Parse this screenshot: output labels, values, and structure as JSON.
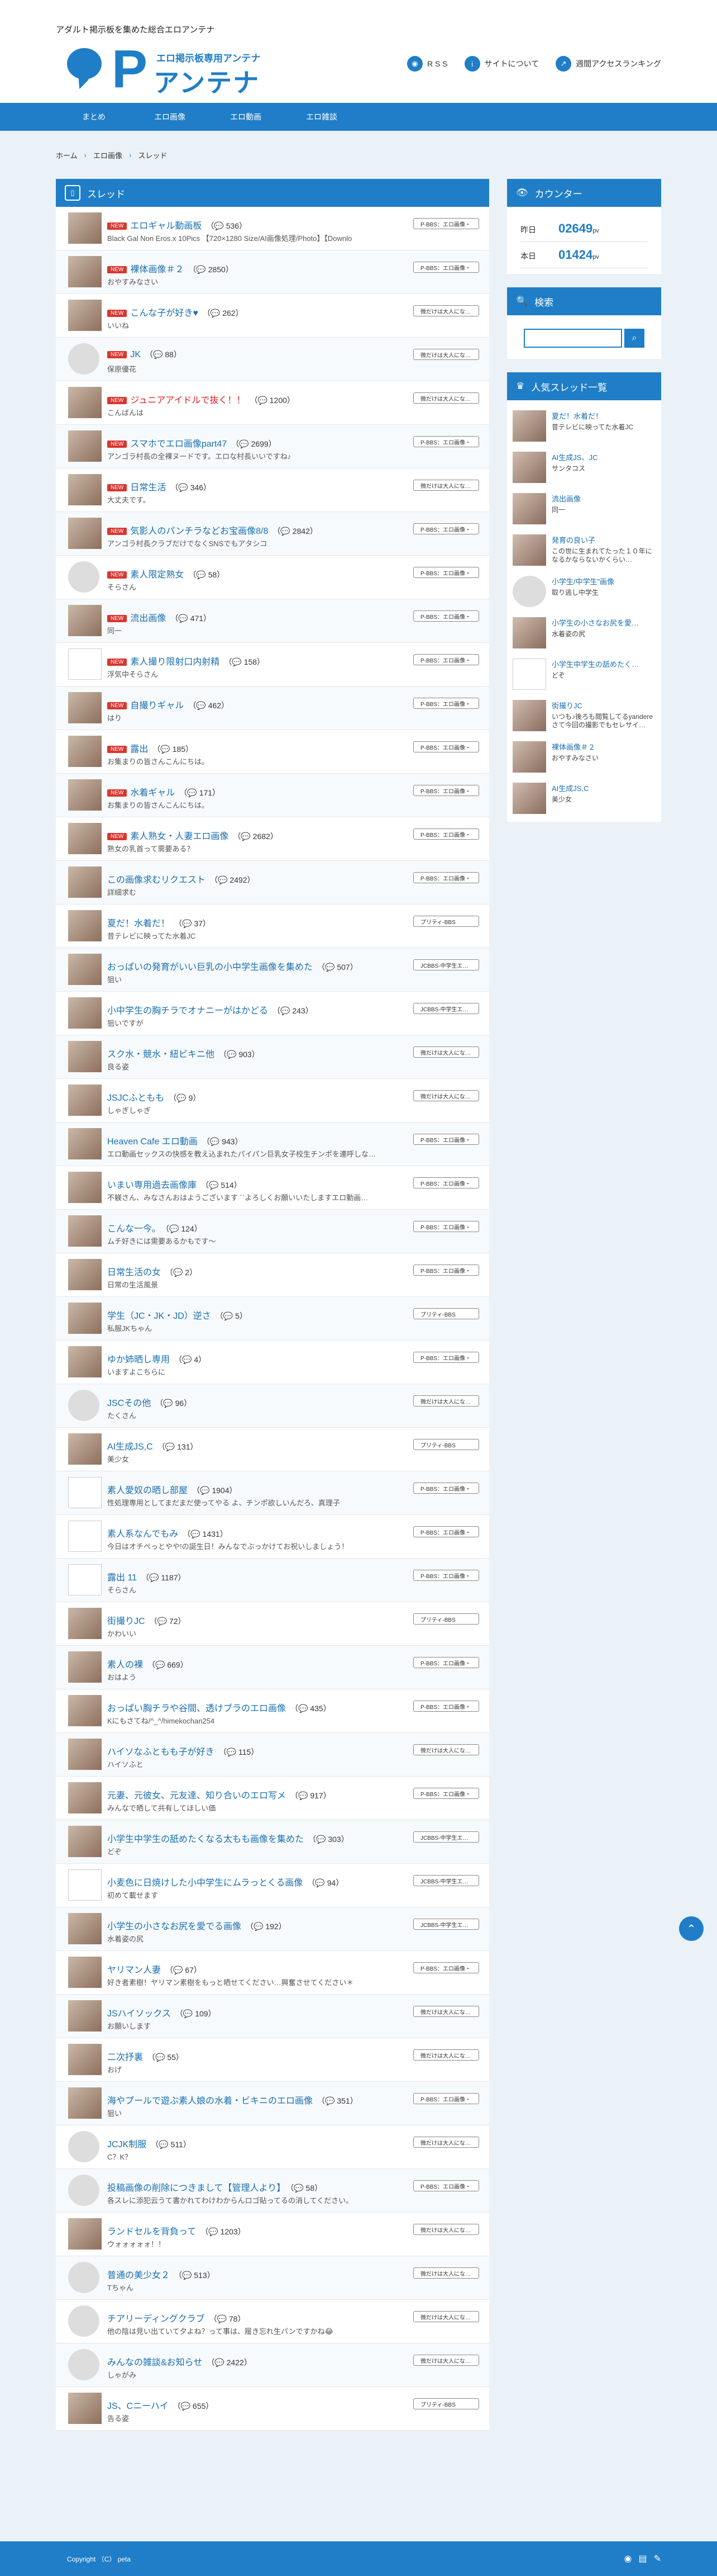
{
  "header": {
    "tagline": "アダルト掲示板を集めた総合エロアンテナ",
    "logo_letter": "P",
    "logo_sub": "エロ掲示板専用アンテナ",
    "logo_main": "アンテナ",
    "links": [
      {
        "icon": "rss-icon",
        "label": "R S S"
      },
      {
        "icon": "info-icon",
        "label": "サイトについて"
      },
      {
        "icon": "ranking-icon",
        "label": "週間アクセスランキング"
      }
    ]
  },
  "nav": [
    "まとめ",
    "エロ画像",
    "エロ動画",
    "エロ雑談"
  ],
  "breadcrumb": [
    "ホーム",
    "エロ画像",
    "スレッド"
  ],
  "threads_heading": "スレッド",
  "threads": [
    {
      "title": "エロギャル動画板",
      "new": true,
      "count": "536",
      "snippet": "Black Gal Non Eros.x 10Pics 【720×1280 Size/AI画像処理/Photo】【Downlo",
      "tag": "P-BBS：エロ画像・",
      "thumb": "photo"
    },
    {
      "title": "裸体画像＃２",
      "new": true,
      "count": "2850",
      "snippet": "おやすみなさい",
      "tag": "P-BBS：エロ画像・",
      "thumb": "photo"
    },
    {
      "title": "こんな子が好き♥",
      "new": true,
      "count": "262",
      "snippet": "いいね",
      "tag": "微だけは大人にな…",
      "thumb": "photo"
    },
    {
      "title": "JK",
      "new": true,
      "count": "88",
      "snippet": "保原優花",
      "tag": "微だけは大人にな…",
      "thumb": "avatar"
    },
    {
      "title": "ジュニアアイドルで抜く！！",
      "new": true,
      "count": "1200",
      "snippet": "こんばんは",
      "tag": "微だけは大人にな…",
      "thumb": "photo",
      "red": true
    },
    {
      "title": "スマホでエロ画像part47",
      "new": true,
      "count": "2699",
      "snippet": "アンゴラ村長の全裸ヌードです。エロな村長いいですね♪",
      "tag": "P-BBS：エロ画像・",
      "thumb": "photo"
    },
    {
      "title": "日常生活",
      "new": true,
      "count": "346",
      "snippet": "大丈夫です。",
      "tag": "微だけは大人にな…",
      "thumb": "photo"
    },
    {
      "title": "気影人のパンチラなどお宝画像8/8",
      "new": true,
      "count": "2842",
      "snippet": "アンゴラ村長クラブだけでなくSNSでもアタシコ",
      "tag": "P-BBS：エロ画像・",
      "thumb": "photo"
    },
    {
      "title": "素人限定熟女",
      "new": true,
      "count": "58",
      "snippet": "そらさん",
      "tag": "P-BBS：エロ画像・",
      "thumb": "avatar"
    },
    {
      "title": "流出画像",
      "new": true,
      "count": "471",
      "snippet": "同一",
      "tag": "P-BBS：エロ画像・",
      "thumb": "photo"
    },
    {
      "title": "素人撮り限射口内射精",
      "new": true,
      "count": "158",
      "snippet": "浮気中そらさん",
      "tag": "P-BBS：エロ画像・",
      "thumb": "blank"
    },
    {
      "title": "自撮りギャル",
      "new": true,
      "count": "462",
      "snippet": "はり",
      "tag": "P-BBS：エロ画像・",
      "thumb": "photo"
    },
    {
      "title": "露出",
      "new": true,
      "count": "185",
      "snippet": "お集まりの皆さんこんにちは。",
      "tag": "P-BBS：エロ画像・",
      "thumb": "photo"
    },
    {
      "title": "水着ギャル",
      "new": true,
      "count": "171",
      "snippet": "お集まりの皆さんこんにちは。",
      "tag": "P-BBS：エロ画像・",
      "thumb": "photo"
    },
    {
      "title": "素人熟女・人妻エロ画像",
      "new": true,
      "count": "2682",
      "snippet": "熟女の乳首って需要ある？",
      "tag": "P-BBS：エロ画像・",
      "thumb": "photo"
    },
    {
      "title": "この画像求むリクエスト",
      "new": false,
      "count": "2492",
      "snippet": "詳細求む",
      "tag": "P-BBS：エロ画像・",
      "thumb": "photo"
    },
    {
      "title": "夏だ！水着だ！",
      "new": false,
      "count": "37",
      "snippet": "昔テレビに映ってた水着JC",
      "tag": "プリティ-BBS",
      "thumb": "photo"
    },
    {
      "title": "おっぱいの発育がいい巨乳の小中学生画像を集めた",
      "new": false,
      "count": "507",
      "snippet": "狙い",
      "tag": "JCBBS-中学生エ…",
      "thumb": "photo"
    },
    {
      "title": "小中学生の胸チラでオナニーがはかどる",
      "new": false,
      "count": "243",
      "snippet": "狙いですが",
      "tag": "JCBBS-中学生エ…",
      "thumb": "photo"
    },
    {
      "title": "スク水・競水・紐ビキニ他",
      "new": false,
      "count": "903",
      "snippet": "良る姿",
      "tag": "微だけは大人にな…",
      "thumb": "photo"
    },
    {
      "title": "JSJCふともも",
      "new": false,
      "count": "9",
      "snippet": "しゃぎしゃぎ",
      "tag": "微だけは大人にな…",
      "thumb": "photo"
    },
    {
      "title": "Heaven Cafe エロ動画",
      "new": false,
      "count": "943",
      "snippet": "エロ動画セックスの快感を教え込まれたパイパン巨乳女子校生チンポを連呼しな…",
      "tag": "P-BBS：エロ画像・",
      "thumb": "photo"
    },
    {
      "title": "いまい専用過去画像庫",
      "new": false,
      "count": "514",
      "snippet": "不躾さん、みなさんおはようございます ´`よろしくお願いいたしますエロ動画…",
      "tag": "P-BBS：エロ画像・",
      "thumb": "photo"
    },
    {
      "title": "こんな一今。",
      "new": false,
      "count": "124",
      "snippet": "ムチ好きには需要あるかもです～",
      "tag": "P-BBS：エロ画像・",
      "thumb": "photo"
    },
    {
      "title": "日常生活の女",
      "new": false,
      "count": "2",
      "snippet": "日常の生活風景",
      "tag": "P-BBS：エロ画像・",
      "thumb": "photo"
    },
    {
      "title": "学生（JC・JK・JD）逆さ",
      "new": false,
      "count": "5",
      "snippet": "私服JKちゃん",
      "tag": "プリティ-BBS",
      "thumb": "photo"
    },
    {
      "title": "ゆか姉晒し専用",
      "new": false,
      "count": "4",
      "snippet": "いますよこちらに",
      "tag": "P-BBS：エロ画像・",
      "thumb": "photo"
    },
    {
      "title": "JSCその他",
      "new": false,
      "count": "96",
      "snippet": "たくさん",
      "tag": "微だけは大人にな…",
      "thumb": "avatar"
    },
    {
      "title": "AI生成JS,C",
      "new": false,
      "count": "131",
      "snippet": "美少女",
      "tag": "プリティ-BBS",
      "thumb": "photo"
    },
    {
      "title": "素人愛奴の晒し部屋",
      "new": false,
      "count": "1904",
      "snippet": "性処理専用としてまだまだ使ってやる よ、チンポ欲しいんだろ、真理子",
      "tag": "P-BBS：エロ画像・",
      "thumb": "blank"
    },
    {
      "title": "素人系なんでもみ",
      "new": false,
      "count": "1431",
      "snippet": "今日はオチぺっとやや!の誕生日！みんなでぶっかけてお祝いしましょう！",
      "tag": "P-BBS：エロ画像・",
      "thumb": "blank"
    },
    {
      "title": "露出 11",
      "new": false,
      "count": "1187",
      "snippet": "そらさん",
      "tag": "P-BBS：エロ画像・",
      "thumb": "blank"
    },
    {
      "title": "街撮りJC",
      "new": false,
      "count": "72",
      "snippet": "かわいい",
      "tag": "プリティ-BBS",
      "thumb": "photo"
    },
    {
      "title": "素人の裸",
      "new": false,
      "count": "669",
      "snippet": "おはよう",
      "tag": "P-BBS：エロ画像・",
      "thumb": "photo"
    },
    {
      "title": "おっぱい胸チラや谷間、透けブラのエロ画像",
      "new": false,
      "count": "435",
      "snippet": "Kにもさてね/^_^/himekochan254",
      "tag": "P-BBS：エロ画像・",
      "thumb": "photo"
    },
    {
      "title": "ハイソなふともも子が好き",
      "new": false,
      "count": "115",
      "snippet": "ハイソふと",
      "tag": "微だけは大人にな…",
      "thumb": "photo"
    },
    {
      "title": "元妻、元彼女、元友達、知り合いのエロ写メ",
      "new": false,
      "count": "917",
      "snippet": "みんなで晒して共有してほしい価",
      "tag": "P-BBS：エロ画像・",
      "thumb": "photo"
    },
    {
      "title": "小学生中学生の舐めたくなる太もも画像を集めた",
      "new": false,
      "count": "303",
      "snippet": "どぞ",
      "tag": "JCBBS-中学生エ…",
      "thumb": "photo"
    },
    {
      "title": "小麦色に日焼けした小中学生にムラっとくる画像",
      "new": false,
      "count": "94",
      "snippet": "初めて載せます",
      "tag": "JCBBS-中学生エ…",
      "thumb": "blank"
    },
    {
      "title": "小学生の小さなお尻を愛でる画像",
      "new": false,
      "count": "192",
      "snippet": "水着姿の尻",
      "tag": "JCBBS-中学生エ…",
      "thumb": "photo"
    },
    {
      "title": "ヤリマン人妻",
      "new": false,
      "count": "67",
      "snippet": "好き者素樹！ヤリマン素樹をもっと晒せてください…興奮させてください＊",
      "tag": "P-BBS：エロ画像・",
      "thumb": "photo"
    },
    {
      "title": "JSハイソックス",
      "new": false,
      "count": "109",
      "snippet": "お願いします",
      "tag": "微だけは大人にな…",
      "thumb": "photo"
    },
    {
      "title": "二次抒裏",
      "new": false,
      "count": "55",
      "snippet": "おげ",
      "tag": "微だけは大人にな…",
      "thumb": "photo"
    },
    {
      "title": "海やプールで遊ぶ素人娘の水着・ビキニのエロ画像",
      "new": false,
      "count": "351",
      "snippet": "狙い",
      "tag": "P-BBS：エロ画像・",
      "thumb": "photo"
    },
    {
      "title": "JCJK制服",
      "new": false,
      "count": "511",
      "snippet": "C？K？",
      "tag": "微だけは大人にな…",
      "thumb": "avatar"
    },
    {
      "title": "投稿画像の削除につきまして【管理人より】",
      "new": false,
      "count": "58",
      "snippet": "各スレに添犯云うて書かれてわけわからんロゴ貼ってるの消してください。",
      "tag": "P-BBS：エロ画像・",
      "thumb": "avatar"
    },
    {
      "title": "ランドセルを背負って",
      "new": false,
      "count": "1203",
      "snippet": "ウォォォォォ！！",
      "tag": "微だけは大人にな…",
      "thumb": "photo"
    },
    {
      "title": "普通の美少女２",
      "new": false,
      "count": "513",
      "snippet": "Tちゃん",
      "tag": "微だけは大人にな…",
      "thumb": "avatar"
    },
    {
      "title": "チアリーディングクラブ",
      "new": false,
      "count": "78",
      "snippet": "他の陰は見い出ていて夕よね？って事は、履き忘れ生パンですかね😂",
      "tag": "微だけは大人にな…",
      "thumb": "avatar"
    },
    {
      "title": "みんなの雑談&お知らせ",
      "new": false,
      "count": "2422",
      "snippet": "しゃがみ",
      "tag": "微だけは大人にな…",
      "thumb": "avatar"
    },
    {
      "title": "JS、Cニーハイ",
      "new": false,
      "count": "655",
      "snippet": "告る姿",
      "tag": "プリティ-BBS",
      "thumb": "photo"
    }
  ],
  "counter": {
    "heading": "カウンター",
    "yesterday_label": "昨日",
    "yesterday_value": "02649",
    "unit": "pv",
    "today_label": "本日",
    "today_value": "01424"
  },
  "search": {
    "heading": "検索",
    "placeholder": ""
  },
  "popular": {
    "heading": "人気スレッド一覧",
    "items": [
      {
        "title": "夏だ！水着だ！",
        "snippet": "昔テレビに映ってた水着JC",
        "thumb": "photo"
      },
      {
        "title": "AI生成JS、JC",
        "snippet": "サンタコス",
        "thumb": "photo"
      },
      {
        "title": "流出画像",
        "snippet": "同一",
        "thumb": "photo"
      },
      {
        "title": "発育の良い子",
        "snippet": "この世に生まれてたった１０年になるかならないかくらい…",
        "thumb": "photo"
      },
      {
        "title": "小学生/中学生”画像",
        "snippet": "取り逃し中学生",
        "thumb": "avatar"
      },
      {
        "title": "小学生の小さなお尻を愛…",
        "snippet": "水着姿の尻",
        "thumb": "photo"
      },
      {
        "title": "小学生中学生の舐めたく…",
        "snippet": "どぞ",
        "thumb": "blank"
      },
      {
        "title": "街撮りJC",
        "snippet": "いつも♪後ろも閲覧してるyandereさて今回の撮影でもセレサイ…",
        "thumb": "photo"
      },
      {
        "title": "裸体画像＃２",
        "snippet": "おやすみなさい",
        "thumb": "photo"
      },
      {
        "title": "AI生成JS,C",
        "snippet": "美少女",
        "thumb": "photo"
      }
    ]
  },
  "footer": {
    "copyright": "Copyright （C） peta"
  }
}
